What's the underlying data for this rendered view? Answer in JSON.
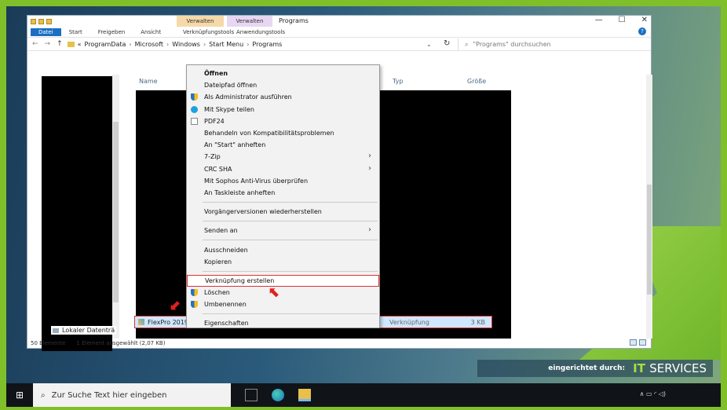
{
  "window": {
    "title": "Programs",
    "context_tabs": [
      "Verwalten",
      "Verwalten"
    ],
    "context_subtabs": [
      "Verknüpfungstools",
      "Anwendungstools"
    ],
    "controls": [
      "—",
      "☐",
      "✕"
    ]
  },
  "ribbon": {
    "tabs": [
      "Datei",
      "Start",
      "Freigeben",
      "Ansicht"
    ],
    "help": "?"
  },
  "address": {
    "back": "←",
    "forward": "→",
    "up": "↑",
    "prefix": "«",
    "crumbs": [
      "ProgramData",
      "Microsoft",
      "Windows",
      "Start Menu",
      "Programs"
    ],
    "separator": "›",
    "dropdown": "⌄",
    "refresh": "↻"
  },
  "search": {
    "placeholder": "\"Programs\" durchsuchen",
    "icon": "search-icon"
  },
  "columns": {
    "name": "Name",
    "type": "Typ",
    "size": "Größe"
  },
  "navpane": {
    "local_drive": "Lokaler Datenträ"
  },
  "file": {
    "name": "FlexPro 2019",
    "type": "Verknüpfung",
    "size": "3 KB"
  },
  "status": {
    "count": "50 Elemente",
    "selected": "1 Element ausgewählt (2,07 KB)"
  },
  "context_menu": {
    "items": [
      {
        "label": "Öffnen",
        "bold": true
      },
      {
        "label": "Dateipfad öffnen"
      },
      {
        "label": "Als Administrator ausführen",
        "icon": "shield-icon"
      },
      {
        "label": "Mit Skype teilen",
        "icon": "skype-icon"
      },
      {
        "label": "PDF24",
        "icon": "document-icon"
      },
      {
        "label": "Behandeln von Kompatibilitätsproblemen"
      },
      {
        "label": "An \"Start\" anheften"
      },
      {
        "label": "7-Zip",
        "submenu": true
      },
      {
        "label": "CRC SHA",
        "submenu": true
      },
      {
        "label": "Mit Sophos Anti-Virus überprüfen"
      },
      {
        "label": "An Taskleiste anheften"
      },
      {
        "label": "Vorgängerversionen wiederherstellen"
      },
      {
        "label": "Senden an",
        "submenu": true
      },
      {
        "label": "Ausschneiden"
      },
      {
        "label": "Kopieren"
      },
      {
        "label": "Verknüpfung erstellen",
        "highlighted": true
      },
      {
        "label": "Löschen",
        "icon": "shield-icon"
      },
      {
        "label": "Umbenennen",
        "icon": "shield-icon"
      },
      {
        "label": "Eigenschaften"
      }
    ],
    "submenu_arrow": "›"
  },
  "branding": {
    "label": "eingerichtet durch:",
    "brand_it": "IT",
    "brand_rest": "SERVICES"
  },
  "taskbar": {
    "search_placeholder": "Zur Suche Text hier eingeben",
    "tray": "∧ ▭ ◜ ◁)"
  },
  "colors": {
    "accent": "#1a6fc4",
    "highlight_border": "#e03030",
    "selection": "#cde8ff",
    "brand_green": "#a6e03d"
  }
}
